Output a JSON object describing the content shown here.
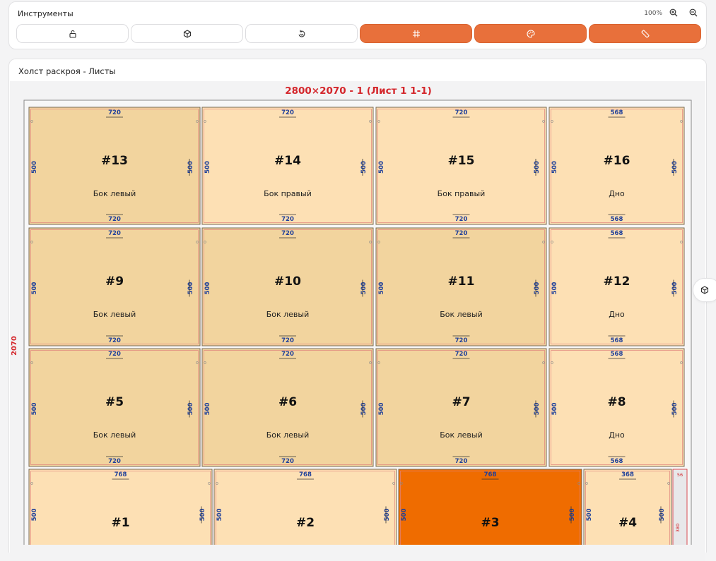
{
  "toolbar": {
    "title": "Инструменты",
    "zoom": "100%",
    "buttons": [
      {
        "name": "lock-button",
        "icon": "lock-open-icon",
        "active": false
      },
      {
        "name": "cube-button",
        "icon": "cube-icon",
        "active": false
      },
      {
        "name": "rotate-button",
        "icon": "rotate-icon",
        "active": false
      },
      {
        "name": "grid-button",
        "icon": "hash-icon",
        "active": true
      },
      {
        "name": "palette-button",
        "icon": "palette-icon",
        "active": true
      },
      {
        "name": "edging-button",
        "icon": "ruler-icon",
        "active": true
      }
    ]
  },
  "canvas": {
    "title": "Холст раскроя - Листы",
    "sheet_title": "2800×2070 - 1 (Лист 1 1-1)",
    "sheet_height_label": "2070",
    "offcut": {
      "width": "56",
      "height": "380"
    }
  },
  "colors": {
    "accent": "#e8703b",
    "sheet_title": "#d4262b",
    "dim_blue": "#1f3f9a",
    "part_light": "#fde0b4",
    "part_mid": "#f2d49e",
    "part_selected": "#ef6c00"
  },
  "parts": [
    {
      "id": "#13",
      "name": "Бок левый",
      "w": "720",
      "h": "500",
      "tone": "mid"
    },
    {
      "id": "#14",
      "name": "Бок правый",
      "w": "720",
      "h": "500",
      "tone": "light"
    },
    {
      "id": "#15",
      "name": "Бок правый",
      "w": "720",
      "h": "500",
      "tone": "light"
    },
    {
      "id": "#16",
      "name": "Дно",
      "w": "568",
      "h": "500",
      "tone": "light"
    },
    {
      "id": "#9",
      "name": "Бок левый",
      "w": "720",
      "h": "500",
      "tone": "mid"
    },
    {
      "id": "#10",
      "name": "Бок левый",
      "w": "720",
      "h": "500",
      "tone": "mid"
    },
    {
      "id": "#11",
      "name": "Бок левый",
      "w": "720",
      "h": "500",
      "tone": "mid"
    },
    {
      "id": "#12",
      "name": "Дно",
      "w": "568",
      "h": "500",
      "tone": "light"
    },
    {
      "id": "#5",
      "name": "Бок левый",
      "w": "720",
      "h": "500",
      "tone": "mid"
    },
    {
      "id": "#6",
      "name": "Бок левый",
      "w": "720",
      "h": "500",
      "tone": "mid"
    },
    {
      "id": "#7",
      "name": "Бок левый",
      "w": "720",
      "h": "500",
      "tone": "mid"
    },
    {
      "id": "#8",
      "name": "Дно",
      "w": "568",
      "h": "500",
      "tone": "light"
    },
    {
      "id": "#1",
      "name": "",
      "w": "768",
      "h": "500",
      "tone": "light"
    },
    {
      "id": "#2",
      "name": "",
      "w": "768",
      "h": "500",
      "tone": "light"
    },
    {
      "id": "#3",
      "name": "",
      "w": "768",
      "h": "500",
      "tone": "selected"
    },
    {
      "id": "#4",
      "name": "",
      "w": "368",
      "h": "500",
      "tone": "light"
    }
  ]
}
